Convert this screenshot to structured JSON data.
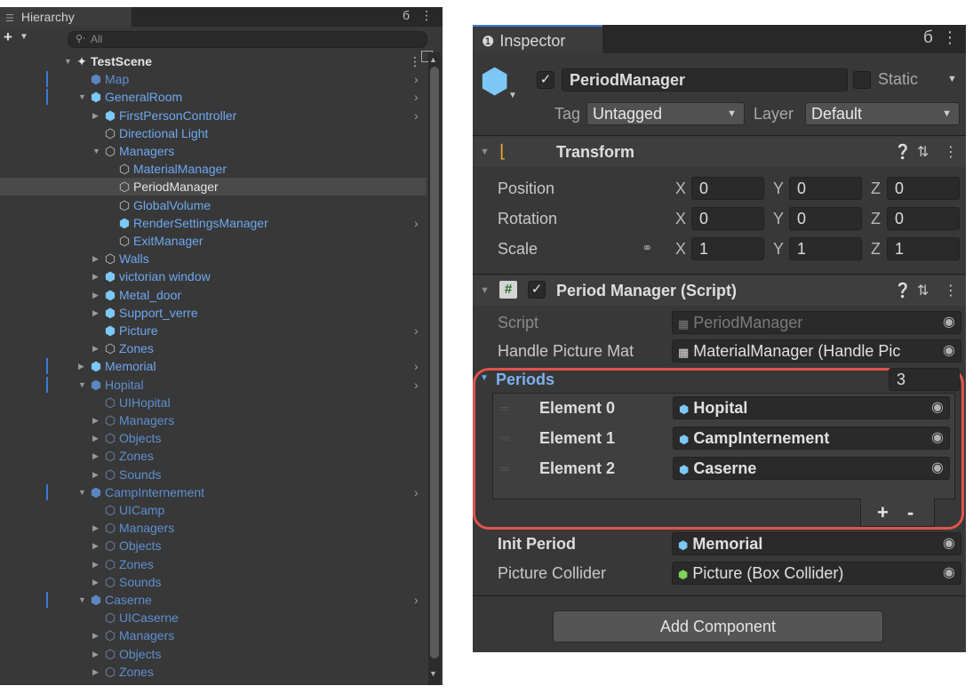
{
  "hierarchy": {
    "tab_label": "Hierarchy",
    "search_placeholder": "All",
    "rows": [
      {
        "label": "TestScene",
        "depth": 0,
        "arrow": "down",
        "icon": "scene-icon",
        "color": "white",
        "bold": true
      },
      {
        "label": "Map",
        "depth": 1,
        "arrow": "none",
        "icon": "prefab-icon",
        "color": "dim",
        "more": true,
        "bar": true
      },
      {
        "label": "GeneralRoom",
        "depth": 1,
        "arrow": "down",
        "icon": "prefab-icon",
        "color": "blue",
        "more": true,
        "bar": true
      },
      {
        "label": "FirstPersonController",
        "depth": 2,
        "arrow": "right",
        "icon": "prefab-icon",
        "color": "blue",
        "more": true
      },
      {
        "label": "Directional Light",
        "depth": 2,
        "arrow": "none",
        "icon": "gameobject-icon",
        "color": "blue"
      },
      {
        "label": "Managers",
        "depth": 2,
        "arrow": "down",
        "icon": "gameobject-icon",
        "color": "blue"
      },
      {
        "label": "MaterialManager",
        "depth": 3,
        "arrow": "none",
        "icon": "gameobject-icon",
        "color": "blue"
      },
      {
        "label": "PeriodManager",
        "depth": 3,
        "arrow": "none",
        "icon": "gameobject-icon",
        "color": "white",
        "selected": true
      },
      {
        "label": "GlobalVolume",
        "depth": 3,
        "arrow": "none",
        "icon": "gameobject-icon",
        "color": "blue"
      },
      {
        "label": "RenderSettingsManager",
        "depth": 3,
        "arrow": "none",
        "icon": "prefab-icon",
        "color": "blue",
        "more": true
      },
      {
        "label": "ExitManager",
        "depth": 3,
        "arrow": "none",
        "icon": "gameobject-icon",
        "color": "blue"
      },
      {
        "label": "Walls",
        "depth": 2,
        "arrow": "right",
        "icon": "gameobject-icon",
        "color": "blue"
      },
      {
        "label": "victorian window",
        "depth": 2,
        "arrow": "right",
        "icon": "model-icon",
        "color": "blue"
      },
      {
        "label": "Metal_door",
        "depth": 2,
        "arrow": "right",
        "icon": "model-icon",
        "color": "blue"
      },
      {
        "label": "Support_verre",
        "depth": 2,
        "arrow": "right",
        "icon": "model-icon",
        "color": "blue"
      },
      {
        "label": "Picture",
        "depth": 2,
        "arrow": "none",
        "icon": "prefab-icon",
        "color": "blue",
        "more": true
      },
      {
        "label": "Zones",
        "depth": 2,
        "arrow": "right",
        "icon": "gameobject-icon",
        "color": "blue"
      },
      {
        "label": "Memorial",
        "depth": 1,
        "arrow": "right",
        "icon": "prefab-icon",
        "color": "blue",
        "more": true,
        "bar": true
      },
      {
        "label": "Hopital",
        "depth": 1,
        "arrow": "down",
        "icon": "prefab-icon",
        "color": "dim",
        "more": true,
        "bar": true
      },
      {
        "label": "UIHopital",
        "depth": 2,
        "arrow": "none",
        "icon": "gameobject-icon",
        "color": "dim"
      },
      {
        "label": "Managers",
        "depth": 2,
        "arrow": "right",
        "icon": "gameobject-icon",
        "color": "dim"
      },
      {
        "label": "Objects",
        "depth": 2,
        "arrow": "right",
        "icon": "gameobject-icon",
        "color": "dim"
      },
      {
        "label": "Zones",
        "depth": 2,
        "arrow": "right",
        "icon": "gameobject-icon",
        "color": "dim"
      },
      {
        "label": "Sounds",
        "depth": 2,
        "arrow": "right",
        "icon": "gameobject-icon",
        "color": "dim"
      },
      {
        "label": "CampInternement",
        "depth": 1,
        "arrow": "down",
        "icon": "prefab-icon",
        "color": "dim",
        "more": true,
        "bar": true
      },
      {
        "label": "UICamp",
        "depth": 2,
        "arrow": "none",
        "icon": "gameobject-icon",
        "color": "dim"
      },
      {
        "label": "Managers",
        "depth": 2,
        "arrow": "right",
        "icon": "gameobject-icon",
        "color": "dim"
      },
      {
        "label": "Objects",
        "depth": 2,
        "arrow": "right",
        "icon": "gameobject-icon",
        "color": "dim"
      },
      {
        "label": "Zones",
        "depth": 2,
        "arrow": "right",
        "icon": "gameobject-icon",
        "color": "dim"
      },
      {
        "label": "Sounds",
        "depth": 2,
        "arrow": "right",
        "icon": "gameobject-icon",
        "color": "dim"
      },
      {
        "label": "Caserne",
        "depth": 1,
        "arrow": "down",
        "icon": "prefab-icon",
        "color": "dim",
        "more": true,
        "bar": true
      },
      {
        "label": "UICaserne",
        "depth": 2,
        "arrow": "none",
        "icon": "gameobject-icon",
        "color": "dim"
      },
      {
        "label": "Managers",
        "depth": 2,
        "arrow": "right",
        "icon": "gameobject-icon",
        "color": "dim"
      },
      {
        "label": "Objects",
        "depth": 2,
        "arrow": "right",
        "icon": "gameobject-icon",
        "color": "dim"
      },
      {
        "label": "Zones",
        "depth": 2,
        "arrow": "right",
        "icon": "gameobject-icon",
        "color": "dim"
      }
    ]
  },
  "inspector": {
    "tab_label": "Inspector",
    "object_name": "PeriodManager",
    "active": true,
    "static_label": "Static",
    "tag_label": "Tag",
    "tag_value": "Untagged",
    "layer_label": "Layer",
    "layer_value": "Default",
    "transform": {
      "title": "Transform",
      "rows": [
        {
          "label": "Position",
          "x": "0",
          "y": "0",
          "z": "0"
        },
        {
          "label": "Rotation",
          "x": "0",
          "y": "0",
          "z": "0"
        },
        {
          "label": "Scale",
          "x": "1",
          "y": "1",
          "z": "1"
        }
      ],
      "axis_labels": {
        "x": "X",
        "y": "Y",
        "z": "Z"
      }
    },
    "script_component": {
      "title": "Period Manager (Script)",
      "script_label": "Script",
      "script_value": "PeriodManager",
      "handle_label": "Handle Picture Mat",
      "handle_value": "MaterialManager (Handle Pic",
      "periods_label": "Periods",
      "periods_count": "3",
      "elements": [
        {
          "label": "Element 0",
          "value": "Hopital"
        },
        {
          "label": "Element 1",
          "value": "CampInternement"
        },
        {
          "label": "Element 2",
          "value": "Caserne"
        }
      ],
      "plus": "+",
      "minus": "-",
      "init_label": "Init Period",
      "init_value": "Memorial",
      "collider_label": "Picture Collider",
      "collider_value": "Picture (Box Collider)"
    },
    "add_component": "Add Component"
  },
  "colors": {
    "panel_bg": "#383838",
    "accent_blue": "#3d7ad6",
    "highlight_red": "#e0534d",
    "prefab_blue": "#7cc8f6"
  }
}
